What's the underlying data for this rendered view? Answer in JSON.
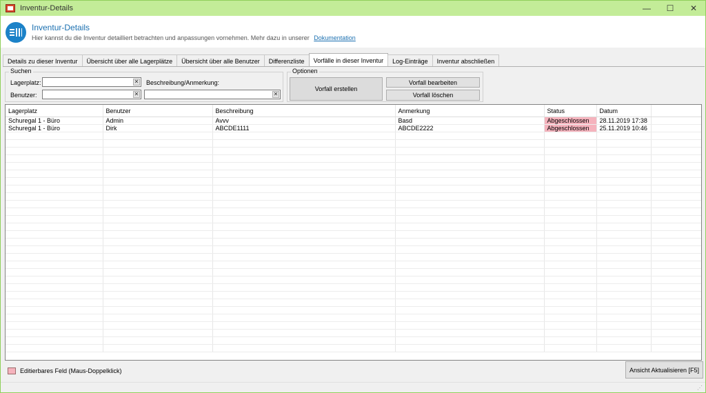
{
  "window": {
    "title": "Inventur-Details",
    "controls": {
      "minimize": "—",
      "maximize": "☐",
      "close": "✕"
    }
  },
  "header": {
    "title": "Inventur-Details",
    "subtitle": "Hier kannst du die Inventur detailliert betrachten und anpassungen vornehmen. Mehr dazu in unserer",
    "link": "Dokumentation"
  },
  "tabs": [
    {
      "label": "Details zu dieser Inventur",
      "active": false
    },
    {
      "label": "Übersicht über alle Lagerplätze",
      "active": false
    },
    {
      "label": "Übersicht über alle Benutzer",
      "active": false
    },
    {
      "label": "Differenzliste",
      "active": false
    },
    {
      "label": "Vorfälle in dieser Inventur",
      "active": true
    },
    {
      "label": "Log-Einträge",
      "active": false
    },
    {
      "label": "Inventur abschließen",
      "active": false
    }
  ],
  "search": {
    "legend": "Suchen",
    "lagerplatz_label": "Lagerplatz:",
    "lagerplatz_value": "",
    "benutzer_label": "Benutzer:",
    "benutzer_value": "",
    "beschreibung_label": "Beschreibung/Anmerkung:",
    "beschreibung_value": "",
    "clear": "✕"
  },
  "options": {
    "legend": "Optionen",
    "create": "Vorfall erstellen",
    "edit": "Vorfall bearbeiten",
    "delete": "Vorfall löschen"
  },
  "grid": {
    "columns": [
      "Lagerplatz",
      "Benutzer",
      "Beschreibung",
      "Anmerkung",
      "Status",
      "Datum"
    ],
    "rows": [
      [
        "Schuregal 1 - Büro",
        "Admin",
        "Avvv",
        "Basd",
        "Abgeschlossen",
        "28.11.2019 17:38"
      ],
      [
        "Schuregal 1 - Büro",
        "Dirk",
        "ABCDE1111",
        "ABCDE2222",
        "Abgeschlossen",
        "25.11.2019 10:46"
      ]
    ]
  },
  "footer": {
    "legend_text": "Editierbares Feld (Maus-Doppelklick)",
    "refresh": "Ansicht Aktualisieren [F5]"
  },
  "colors": {
    "editable": "#f5b3bd",
    "accent": "#1a6fb0",
    "titlebar": "#c3ec98"
  }
}
